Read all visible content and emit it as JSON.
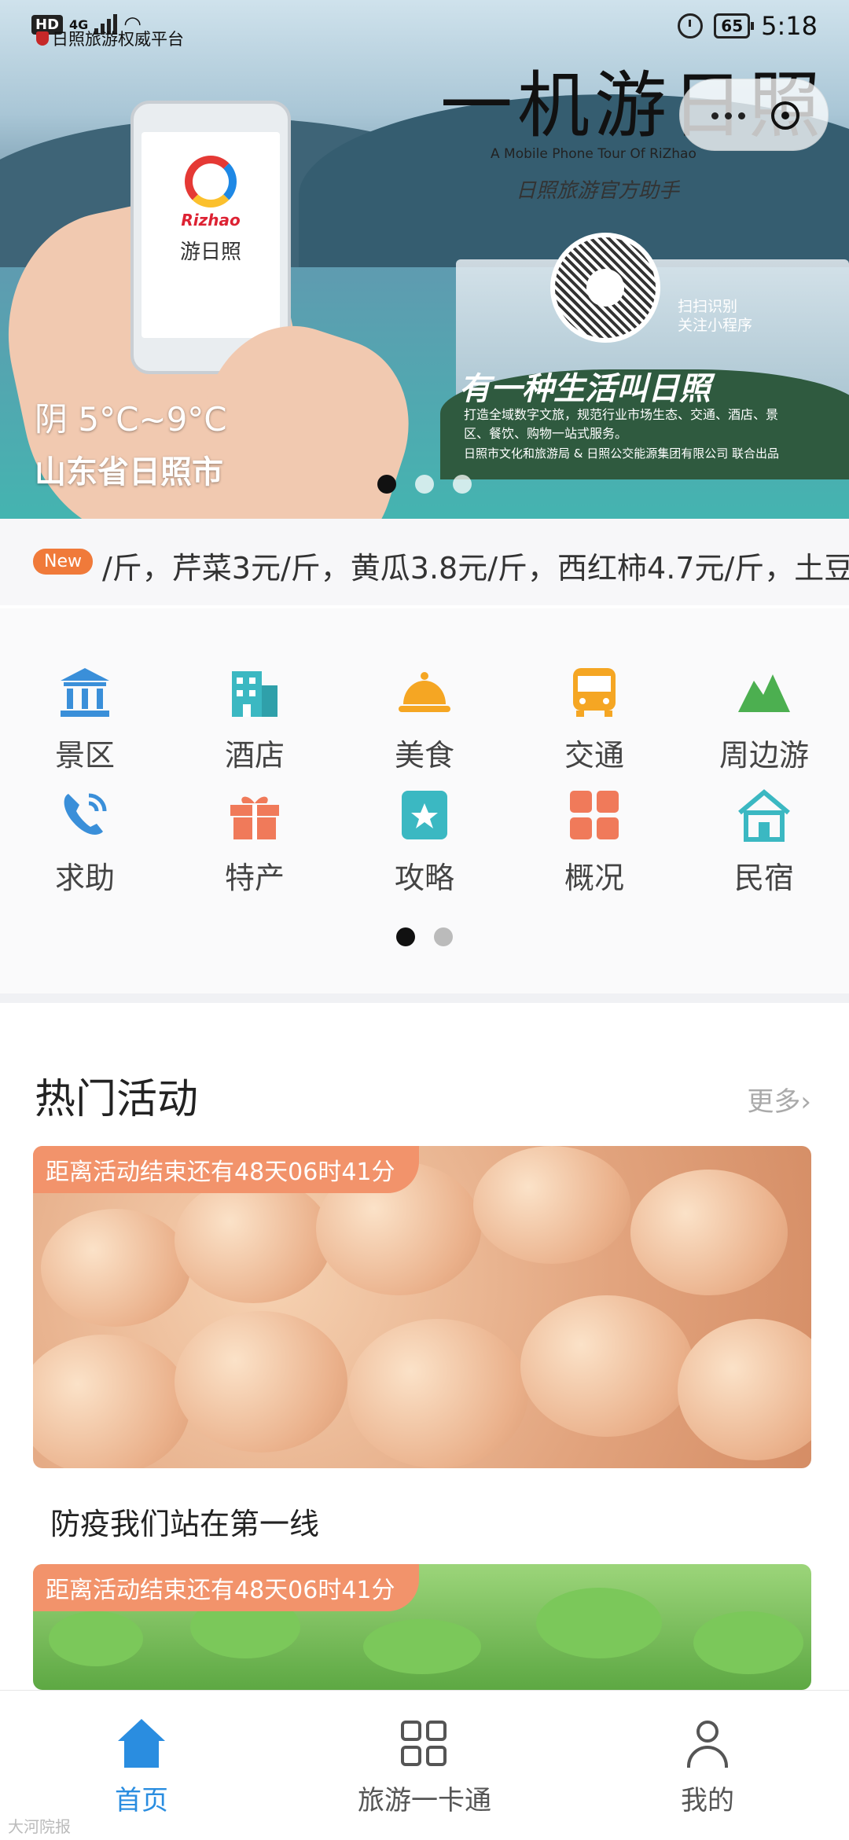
{
  "status_bar": {
    "hd": "HD",
    "network": "4G",
    "battery": "65",
    "time": "5:18",
    "source_watermark": "日照旅游权威平台"
  },
  "banner": {
    "title": "一机游日照",
    "subtitle_en": "A Mobile Phone Tour Of RiZhao",
    "helper": "日照旅游官方助手",
    "phone_brand": "Rizhao",
    "phone_app_name": "游日照",
    "qr_label_line1": "扫扫识别",
    "qr_label_line2": "关注小程序",
    "slogan": "有一种生活叫日照",
    "description": "打造全域数字文旅，规范行业市场生态、交通、酒店、景区、餐饮、购物一站式服务。",
    "sponsor": "日照市文化和旅游局 & 日照公交能源集团有限公司 联合出品",
    "weather": "阴 5°C~9°C",
    "city": "山东省日照市",
    "slide_count": 3,
    "active_slide": 1
  },
  "ticker": {
    "badge": "New",
    "text": "/斤，芹菜3元/斤，黄瓜3.8元/斤，西红柿4.7元/斤，土豆"
  },
  "categories": {
    "items": [
      {
        "label": "景区",
        "icon": "scenic-spot-icon",
        "color": "#3a8fd9"
      },
      {
        "label": "酒店",
        "icon": "hotel-icon",
        "color": "#3bb8c2"
      },
      {
        "label": "美食",
        "icon": "food-cloche-icon",
        "color": "#f5a623"
      },
      {
        "label": "交通",
        "icon": "bus-icon",
        "color": "#f5a623"
      },
      {
        "label": "周边游",
        "icon": "mountain-icon",
        "color": "#4caf50"
      },
      {
        "label": "求助",
        "icon": "phone-call-icon",
        "color": "#3a8fd9"
      },
      {
        "label": "特产",
        "icon": "gift-icon",
        "color": "#f07a5a"
      },
      {
        "label": "攻略",
        "icon": "guide-book-icon",
        "color": "#3bb8c2"
      },
      {
        "label": "概况",
        "icon": "overview-grid-icon",
        "color": "#f07a5a"
      },
      {
        "label": "民宿",
        "icon": "homestay-icon",
        "color": "#3bb8c2"
      }
    ],
    "page_count": 2,
    "active_page": 1
  },
  "hot_activities": {
    "title": "热门活动",
    "more": "更多",
    "cards": [
      {
        "countdown": "距离活动结束还有48天06时41分",
        "caption": "防疫我们站在第一线"
      },
      {
        "countdown": "距离活动结束还有48天06时41分",
        "caption": ""
      }
    ]
  },
  "bottom_nav": {
    "items": [
      {
        "label": "首页",
        "icon": "home-icon",
        "active": true
      },
      {
        "label": "旅游一卡通",
        "icon": "card-grid-icon",
        "active": false
      },
      {
        "label": "我的",
        "icon": "user-icon",
        "active": false
      }
    ],
    "active_color": "#2a8de0"
  },
  "footer_watermark": "大河院报"
}
